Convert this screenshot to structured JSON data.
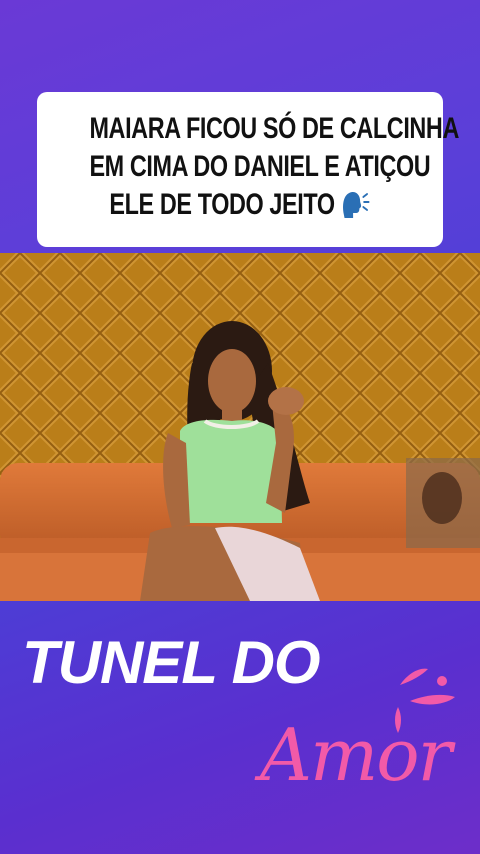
{
  "caption": {
    "lines": [
      "MAIARA FICOU SÓ DE CALCINHA",
      "EM CIMA DO DANIEL E ATIÇOU",
      "ELE DE TODO JEITO"
    ],
    "emoji": "speaking-head-icon"
  },
  "video": {
    "description_icon": "video-frame"
  },
  "brand": {
    "title": "TUNEL DO",
    "script": "Amor"
  },
  "colors": {
    "background_top": "#6a39d6",
    "background_bottom": "#6d2ec9",
    "script_pink": "#f25aa8",
    "caption_bg": "#ffffff",
    "caption_text": "#111111"
  }
}
